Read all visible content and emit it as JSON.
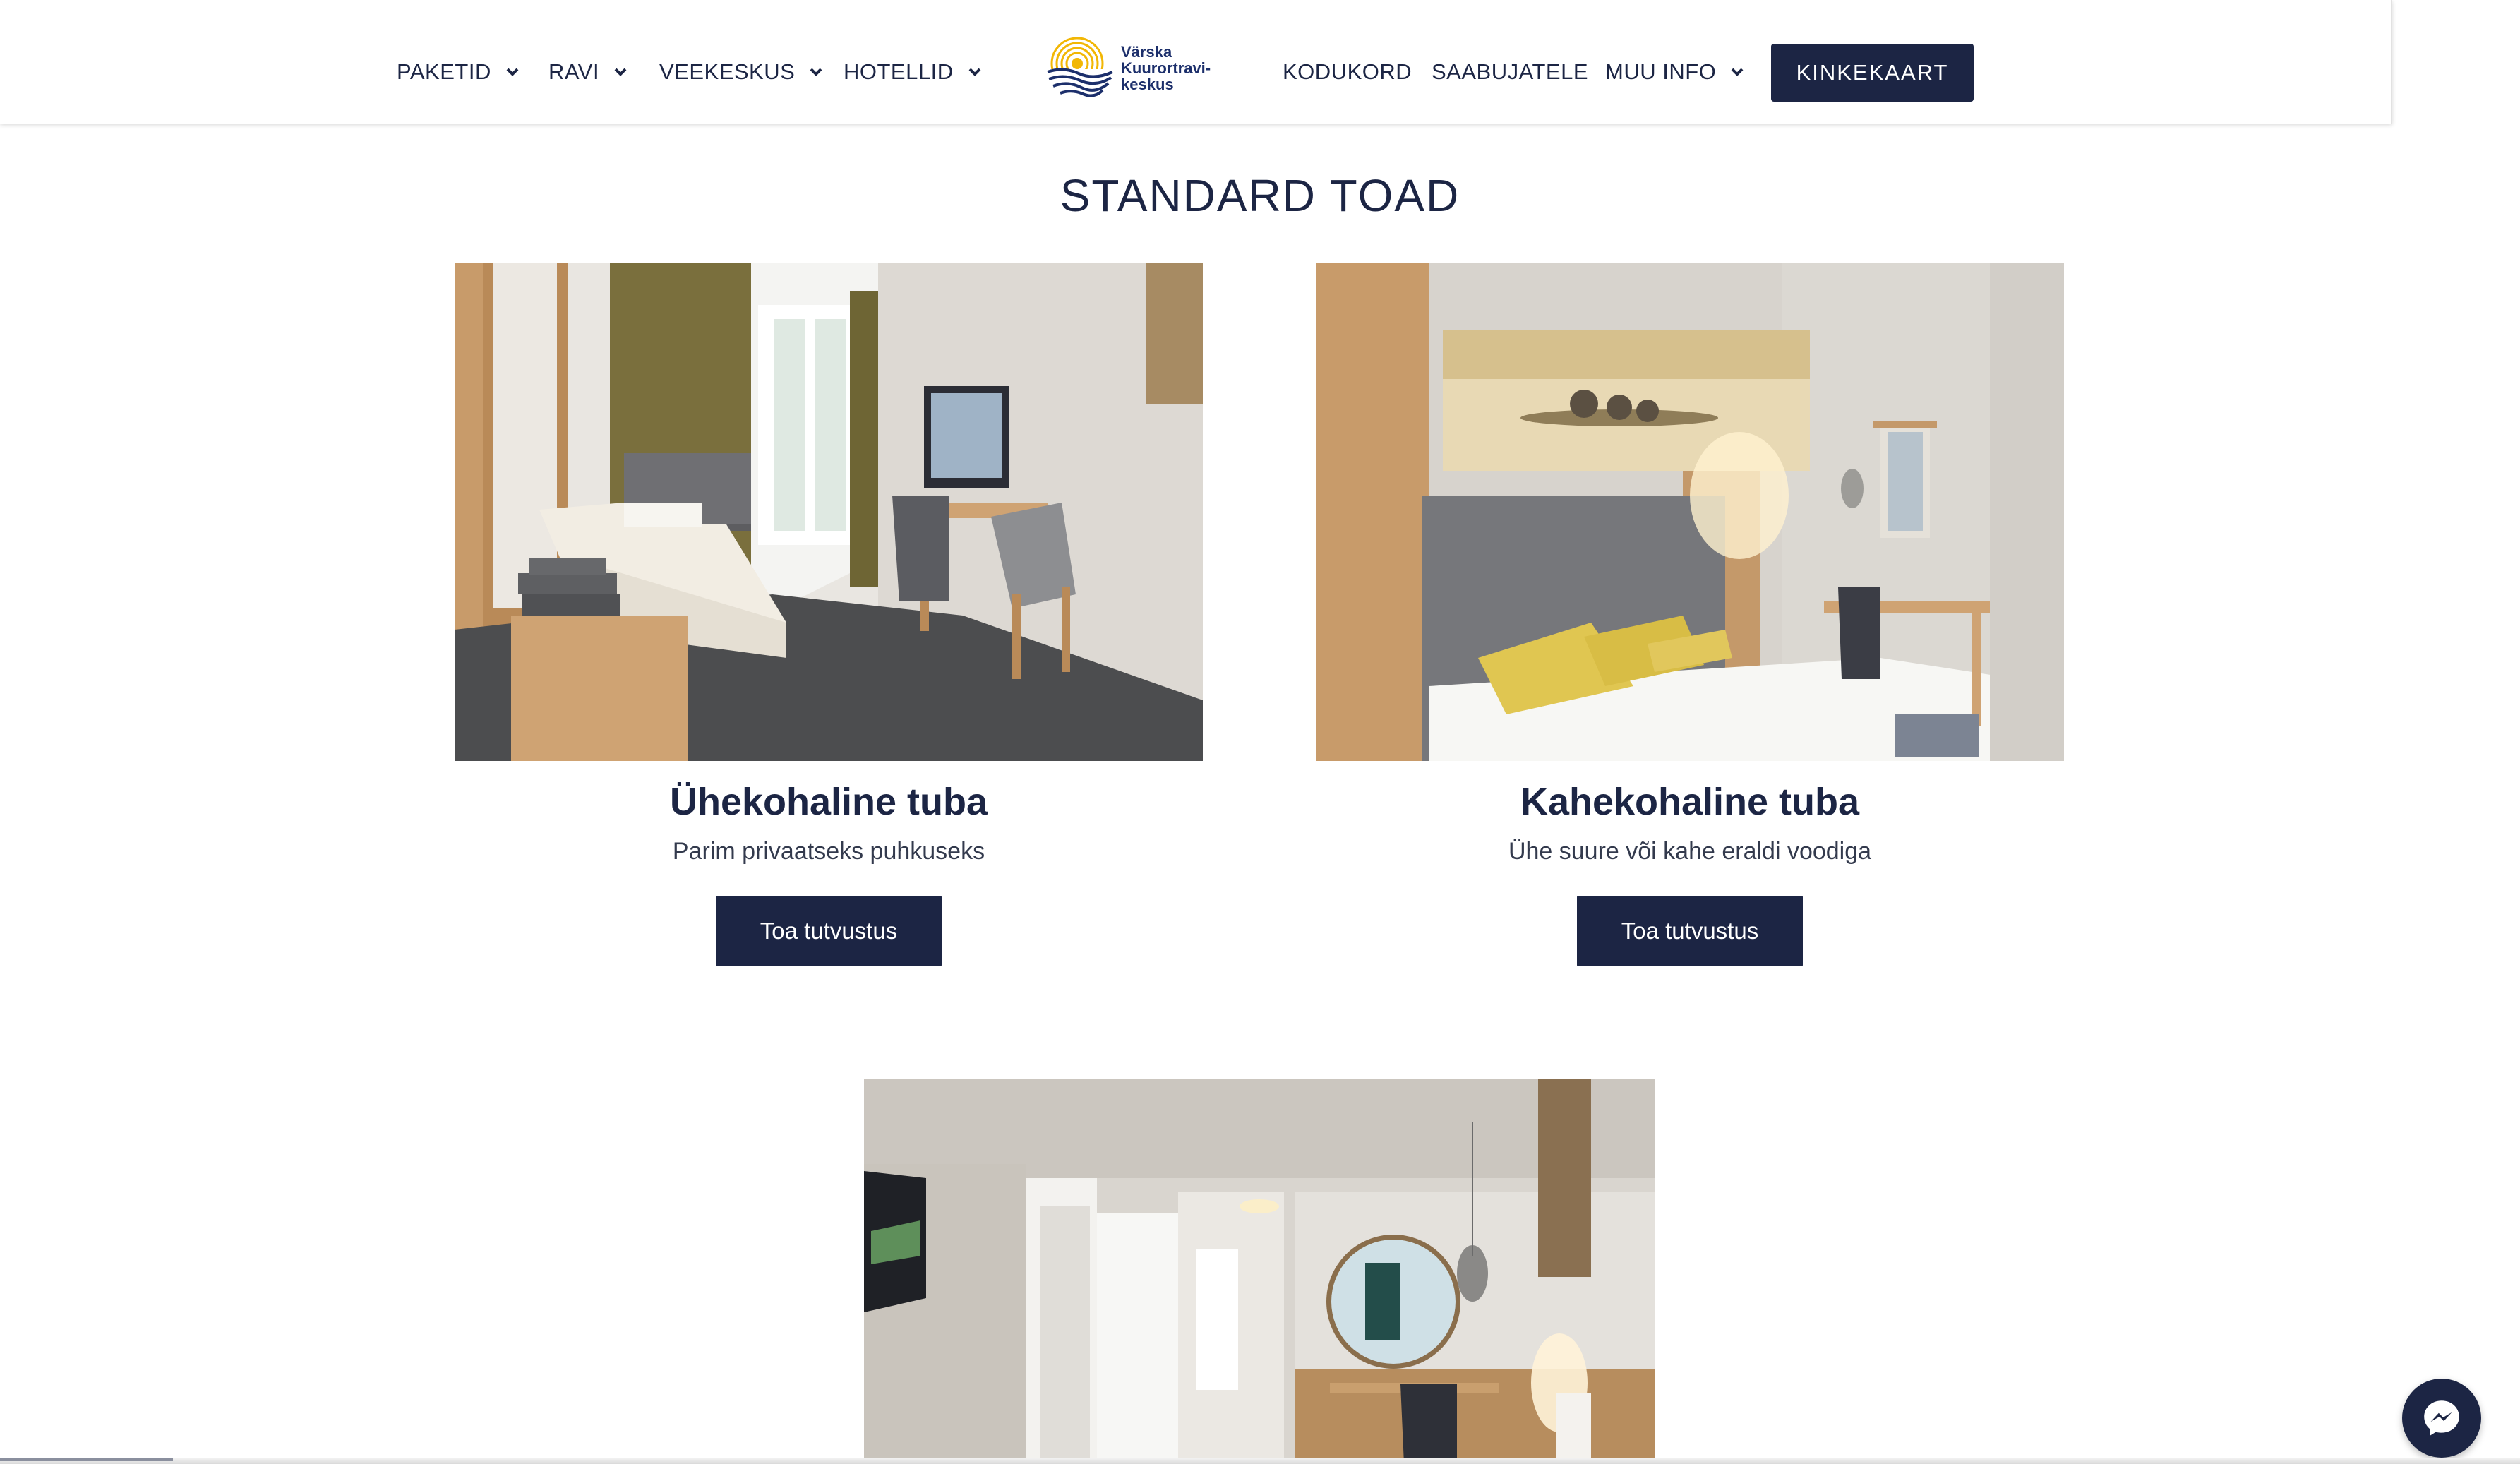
{
  "header": {
    "nav_left": [
      {
        "label": "PAKETID",
        "has_dropdown": true
      },
      {
        "label": "RAVI",
        "has_dropdown": true
      },
      {
        "label": "VEEKESKUS",
        "has_dropdown": true
      },
      {
        "label": "HOTELLID",
        "has_dropdown": true
      }
    ],
    "logo": {
      "line1": "Värska",
      "line2": "Kuurortravi-",
      "line3": "keskus",
      "icon": "sun-waves-logo"
    },
    "nav_right": [
      {
        "label": "KODUKORD",
        "has_dropdown": false
      },
      {
        "label": "SAABUJATELE",
        "has_dropdown": false
      },
      {
        "label": "MUU INFO",
        "has_dropdown": true
      }
    ],
    "cta_label": "KINKEKAART"
  },
  "section": {
    "title": "STANDARD TOAD",
    "rooms": [
      {
        "name": "Ühekohaline tuba",
        "description": "Parim privaatseks puhkuseks",
        "button_label": "Toa tutvustus"
      },
      {
        "name": "Kahekohaline tuba",
        "description": "Ühe suure või kahe eraldi voodiga",
        "button_label": "Toa tutvustus"
      }
    ]
  },
  "widgets": {
    "messenger_icon": "messenger-icon"
  },
  "colors": {
    "primary": "#1c2544",
    "logo_yellow": "#f2b705",
    "logo_blue": "#1c2f6b",
    "white": "#ffffff"
  }
}
